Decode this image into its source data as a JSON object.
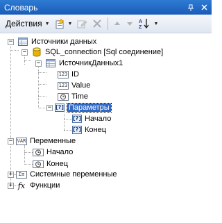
{
  "window": {
    "title": "Словарь"
  },
  "toolbar": {
    "actions_label": "Действия"
  },
  "tree": {
    "datasources": "Источники данных",
    "connection": "SQL_connection [Sql соединение]",
    "datasource1": "ИсточникДанных1",
    "field_id": "ID",
    "field_value": "Value",
    "field_time": "Time",
    "params": "Параметры",
    "param_start": "Начало",
    "param_end": "Конец",
    "variables": "Переменные",
    "var_start": "Начало",
    "var_end": "Конец",
    "system_vars": "Системные переменные",
    "functions": "Функции"
  },
  "colors": {
    "title_bar": "#1f66c1",
    "selection": "#316ac5"
  }
}
